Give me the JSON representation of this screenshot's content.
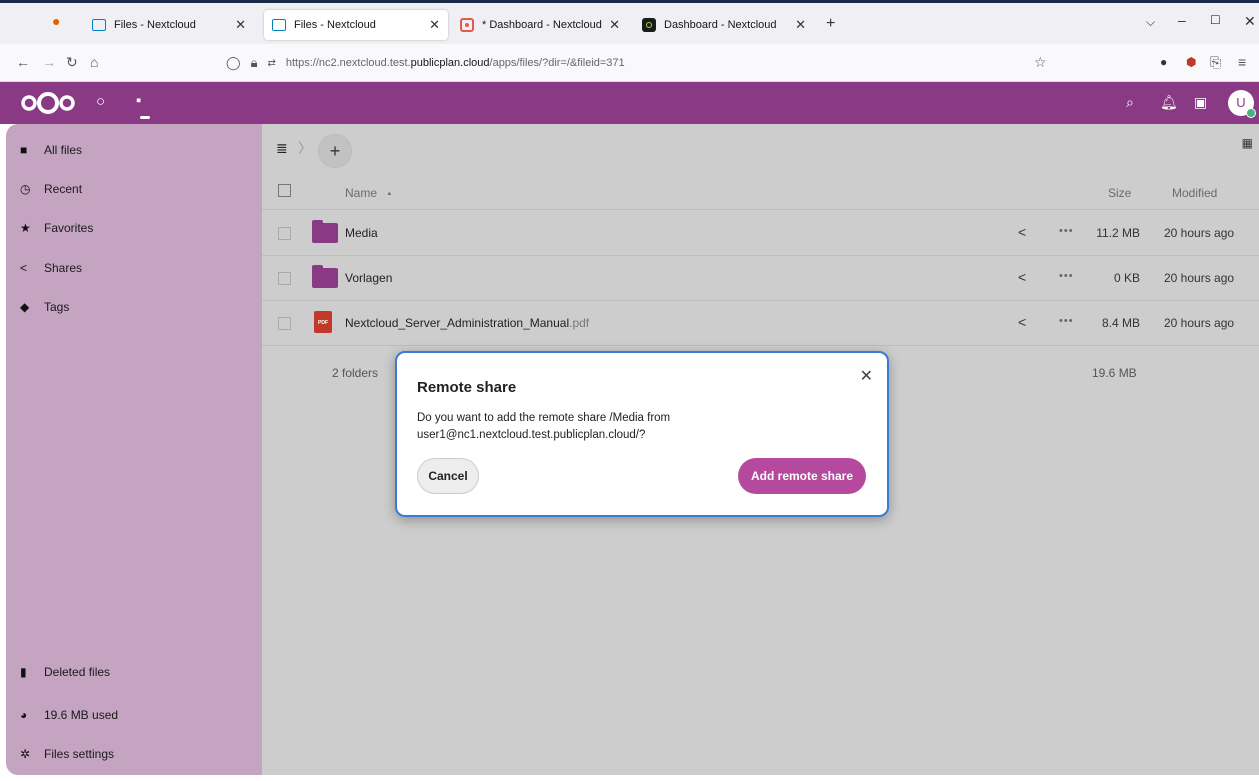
{
  "browser": {
    "tabs": [
      {
        "title": "Files - Nextcloud",
        "active": false
      },
      {
        "title": "Files - Nextcloud",
        "active": true
      },
      {
        "title": "* Dashboard - Nextcloud",
        "active": false
      },
      {
        "title": "Dashboard - Nextcloud",
        "active": false
      }
    ],
    "url_prefix": "https://nc2.nextcloud.test.",
    "url_host": "publicplan.cloud",
    "url_path": "/apps/files/?dir=/&fileid=371"
  },
  "sidebar": {
    "items": [
      {
        "label": "All files",
        "icon": "folder-icon"
      },
      {
        "label": "Recent",
        "icon": "clock-icon"
      },
      {
        "label": "Favorites",
        "icon": "star-icon"
      },
      {
        "label": "Shares",
        "icon": "share-icon"
      },
      {
        "label": "Tags",
        "icon": "tag-icon"
      }
    ],
    "bottom": [
      {
        "label": "Deleted files",
        "icon": "trash-icon"
      },
      {
        "label": "19.6 MB used",
        "icon": "pie-chart-icon"
      },
      {
        "label": "Files settings",
        "icon": "gear-icon"
      }
    ]
  },
  "files": {
    "columns": {
      "name": "Name",
      "sort_indicator": "▲",
      "size": "Size",
      "modified": "Modified"
    },
    "rows": [
      {
        "name": "Media",
        "ext": "",
        "type": "folder",
        "size": "11.2 MB",
        "modified": "20 hours ago"
      },
      {
        "name": "Vorlagen",
        "ext": "",
        "type": "folder",
        "size": "0 KB",
        "modified": "20 hours ago"
      },
      {
        "name": "Nextcloud_Server_Administration_Manual",
        "ext": ".pdf",
        "type": "pdf",
        "size": "8.4 MB",
        "modified": "20 hours ago"
      }
    ],
    "summary": "2 folders",
    "total_size": "19.6 MB",
    "pdf_badge": "PDF"
  },
  "header": {
    "avatar_letter": "U"
  },
  "dialog": {
    "title": "Remote share",
    "message": "Do you want to add the remote share /Media from user1@nc1.nextcloud.test.publicplan.cloud/?",
    "cancel_label": "Cancel",
    "confirm_label": "Add remote share"
  },
  "colors": {
    "brand": "#8a3a84",
    "primary_button": "#b5499e",
    "focus_border": "#3a7bd5"
  }
}
